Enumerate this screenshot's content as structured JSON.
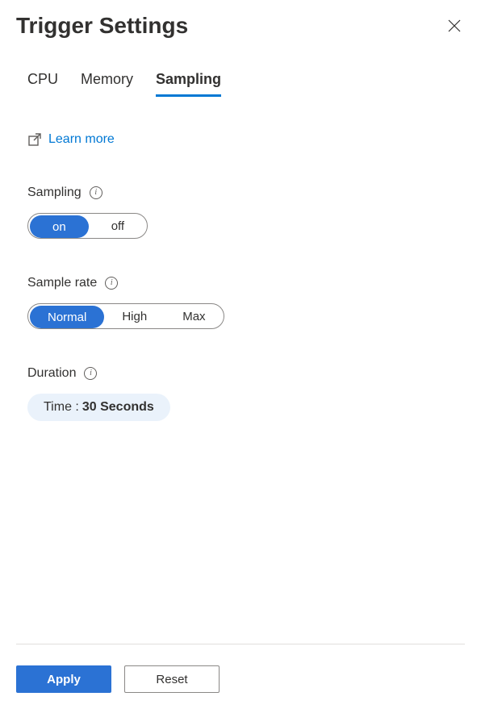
{
  "header": {
    "title": "Trigger Settings"
  },
  "tabs": {
    "items": [
      {
        "label": "CPU",
        "active": false
      },
      {
        "label": "Memory",
        "active": false
      },
      {
        "label": "Sampling",
        "active": true
      }
    ]
  },
  "learnMore": {
    "label": "Learn more"
  },
  "sections": {
    "sampling": {
      "label": "Sampling",
      "options": [
        "on",
        "off"
      ],
      "selected": "on"
    },
    "sampleRate": {
      "label": "Sample rate",
      "options": [
        "Normal",
        "High",
        "Max"
      ],
      "selected": "Normal"
    },
    "duration": {
      "label": "Duration",
      "timeLabel": "Time : ",
      "timeValue": "30 Seconds"
    }
  },
  "footer": {
    "apply": "Apply",
    "reset": "Reset"
  }
}
